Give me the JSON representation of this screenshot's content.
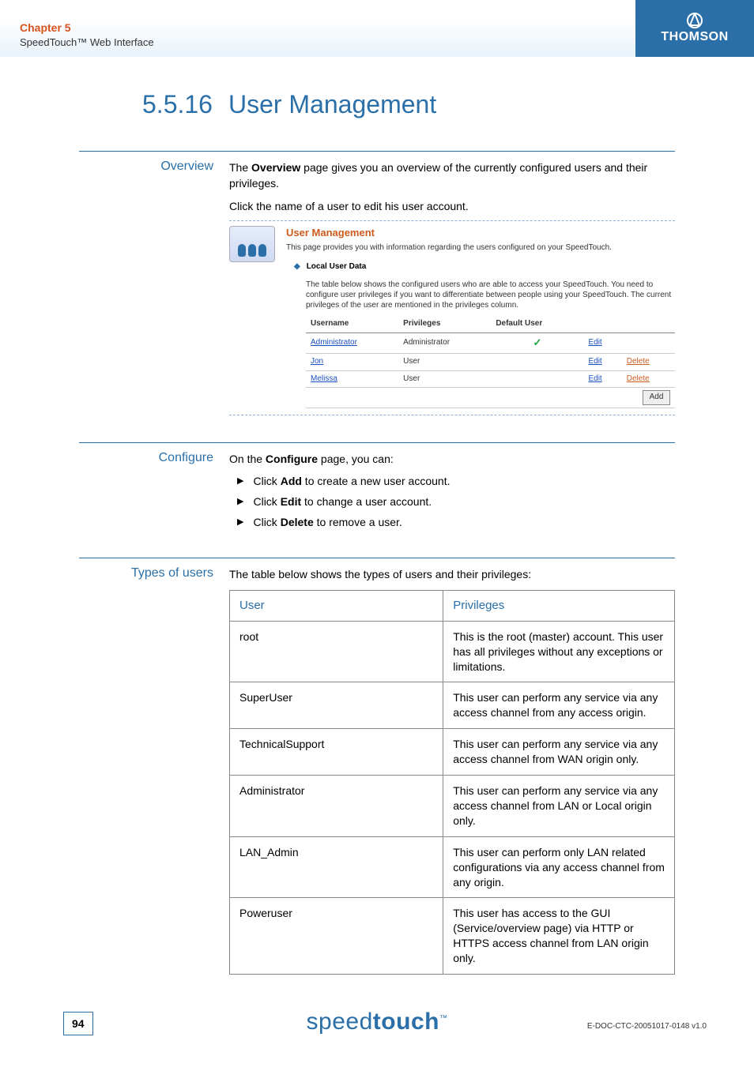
{
  "header": {
    "chapter": "Chapter 5",
    "subtitle": "SpeedTouch™ Web Interface",
    "brand": "THOMSON"
  },
  "title": {
    "number": "5.5.16",
    "text": "User Management"
  },
  "overview": {
    "label": "Overview",
    "p1_a": "The ",
    "p1_b": "Overview",
    "p1_c": " page gives you an overview of the currently configured users and their privileges.",
    "p2": "Click the name of a user to edit his user account."
  },
  "screenshot": {
    "title": "User Management",
    "desc": "This page provides you with information regarding the users configured on your SpeedTouch.",
    "bullet": "Local User Data",
    "para": "The table below shows the configured users who are able to access your SpeedTouch. You need to configure user privileges if you want to differentiate between people using your SpeedTouch. The current privileges of the user are mentioned in the privileges column.",
    "cols": {
      "c1": "Username",
      "c2": "Privileges",
      "c3": "Default User"
    },
    "rows": [
      {
        "user": "Administrator",
        "priv": "Administrator",
        "def": "✓",
        "edit": "Edit",
        "del": ""
      },
      {
        "user": "Jon",
        "priv": "User",
        "def": "",
        "edit": "Edit",
        "del": "Delete"
      },
      {
        "user": "Melissa",
        "priv": "User",
        "def": "",
        "edit": "Edit",
        "del": "Delete"
      }
    ],
    "add": "Add"
  },
  "configure": {
    "label": "Configure",
    "intro_a": "On the ",
    "intro_b": "Configure",
    "intro_c": " page, you can:",
    "items": [
      {
        "a": "Click ",
        "b": "Add",
        "c": " to create a new user account."
      },
      {
        "a": "Click ",
        "b": "Edit",
        "c": " to change a user account."
      },
      {
        "a": "Click ",
        "b": "Delete",
        "c": " to remove a user."
      }
    ]
  },
  "types": {
    "label": "Types of users",
    "intro": "The table below shows the types of users and their privileges:",
    "head": {
      "c1": "User",
      "c2": "Privileges"
    },
    "rows": [
      {
        "u": "root",
        "p": "This is the root (master) account. This user has all privileges without any exceptions or limitations."
      },
      {
        "u": "SuperUser",
        "p": "This user can perform any service via any access channel from any access origin."
      },
      {
        "u": "TechnicalSupport",
        "p": "This user can perform any service via any access channel from WAN origin only."
      },
      {
        "u": "Administrator",
        "p": "This user can perform any service via any access channel from LAN or Local origin only."
      },
      {
        "u": "LAN_Admin",
        "p": "This user can perform only LAN related configurations via any access channel from any origin."
      },
      {
        "u": "Poweruser",
        "p": "This user has access to the GUI (Service/overview page) via HTTP or HTTPS access channel from LAN origin only."
      }
    ]
  },
  "footer": {
    "page": "94",
    "logo_a": "speed",
    "logo_b": "touch",
    "tm": "™",
    "docid": "E-DOC-CTC-20051017-0148 v1.0"
  }
}
